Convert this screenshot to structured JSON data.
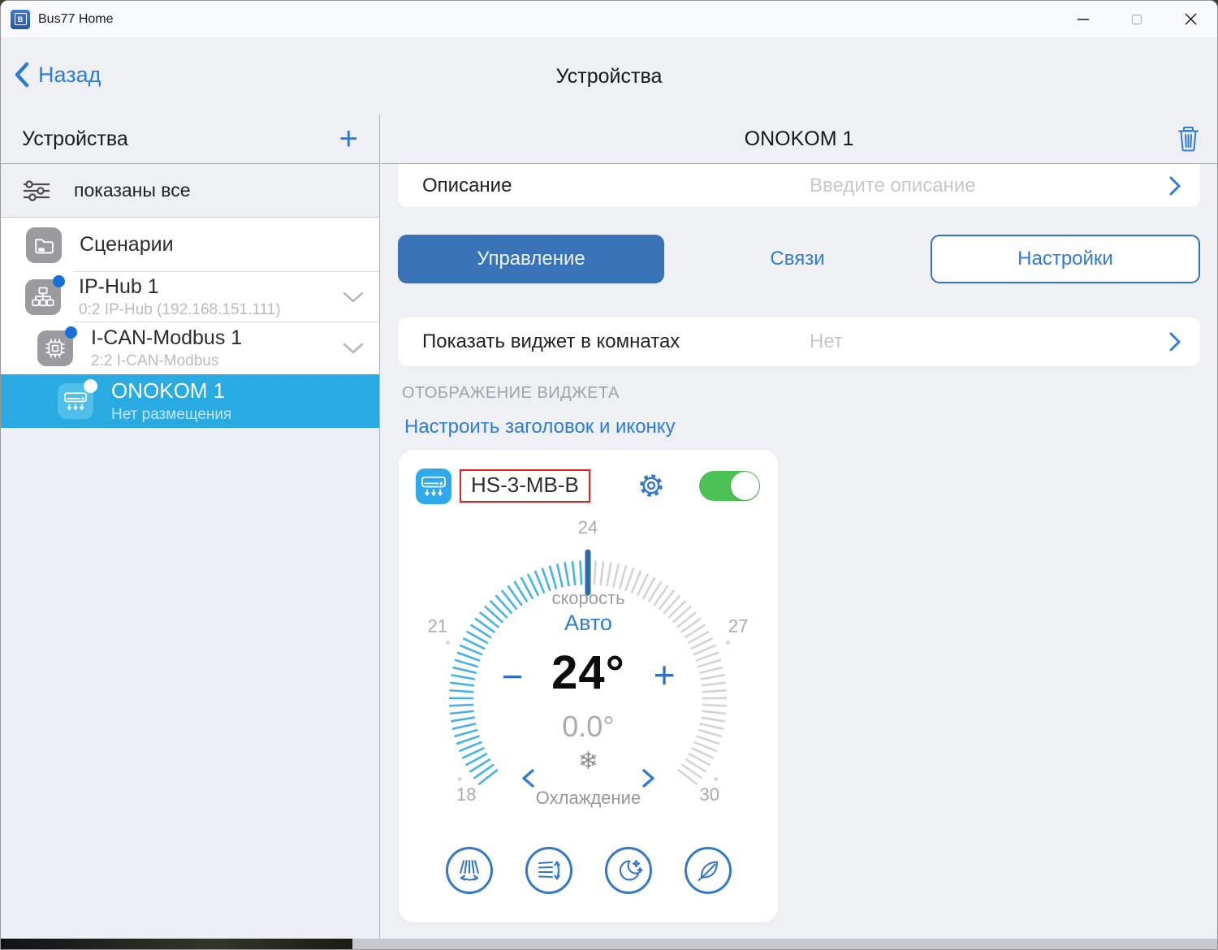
{
  "window": {
    "title": "Bus77 Home"
  },
  "nav": {
    "back_label": "Назад",
    "title": "Устройства"
  },
  "sidebar": {
    "header": {
      "title": "Устройства",
      "add_label": "+"
    },
    "filter": {
      "label": "показаны все"
    },
    "items": [
      {
        "label": "Сценарии",
        "subtitle": "",
        "icon": "folder",
        "level": 0,
        "badge": false,
        "expandable": false,
        "selected": false
      },
      {
        "label": "IP-Hub 1",
        "subtitle": "0:2 IP-Hub (192.168.151.111)",
        "icon": "hub",
        "level": 0,
        "badge": true,
        "expandable": true,
        "selected": false
      },
      {
        "label": "I-CAN-Modbus 1",
        "subtitle": "2:2 I-CAN-Modbus",
        "icon": "chip",
        "level": 1,
        "badge": true,
        "expandable": true,
        "selected": false
      },
      {
        "label": "ONOKOM 1",
        "subtitle": "Нет размещения",
        "icon": "ac",
        "level": 2,
        "badge": true,
        "expandable": false,
        "selected": true
      }
    ]
  },
  "panel": {
    "title": "ONOKOM 1",
    "description_row": {
      "label": "Описание",
      "placeholder": "Введите описание"
    },
    "tabs": [
      {
        "label": "Управление",
        "slug": "control",
        "state": "active"
      },
      {
        "label": "Связи",
        "slug": "links",
        "state": "normal"
      },
      {
        "label": "Настройки",
        "slug": "settings",
        "state": "outlined"
      }
    ],
    "widget_room_row": {
      "label": "Показать виджет в комнатах",
      "value": "Нет"
    },
    "section_label": "ОТОБРАЖЕНИЕ ВИДЖЕТА",
    "configure_link": "Настроить заголовок и иконку"
  },
  "widget": {
    "name": "HS-3-MB-B",
    "power_on": true,
    "dial": {
      "min": 18,
      "max": 30,
      "current": 24,
      "sweep_deg": 256,
      "scale_labels": [
        {
          "text": "18",
          "value": 18
        },
        {
          "text": "21",
          "value": 21
        },
        {
          "text": "24",
          "value": 24
        },
        {
          "text": "27",
          "value": 27
        },
        {
          "text": "30",
          "value": 30
        }
      ],
      "speed_label": "скорость",
      "speed_value": "Авто",
      "temp_display": "24°",
      "current_temp_display": "0.0°",
      "minus_label": "−",
      "plus_label": "+",
      "mode_glyph": "❄",
      "mode_label": "Охлаждение"
    },
    "function_buttons": [
      "swing-horizontal",
      "swing-vertical",
      "sleep-mode",
      "eco-mode"
    ]
  },
  "colors": {
    "accent_blue": "#2e7cd6",
    "tab_active": "#3a72b8",
    "selected_row": "#29abe2",
    "toggle_on_green": "#4cc254",
    "dial_active": "#47b2e8",
    "dial_inactive": "#d3d4d6",
    "dial_marker": "#2d6cb0",
    "highlight_red": "#e01f1f"
  }
}
